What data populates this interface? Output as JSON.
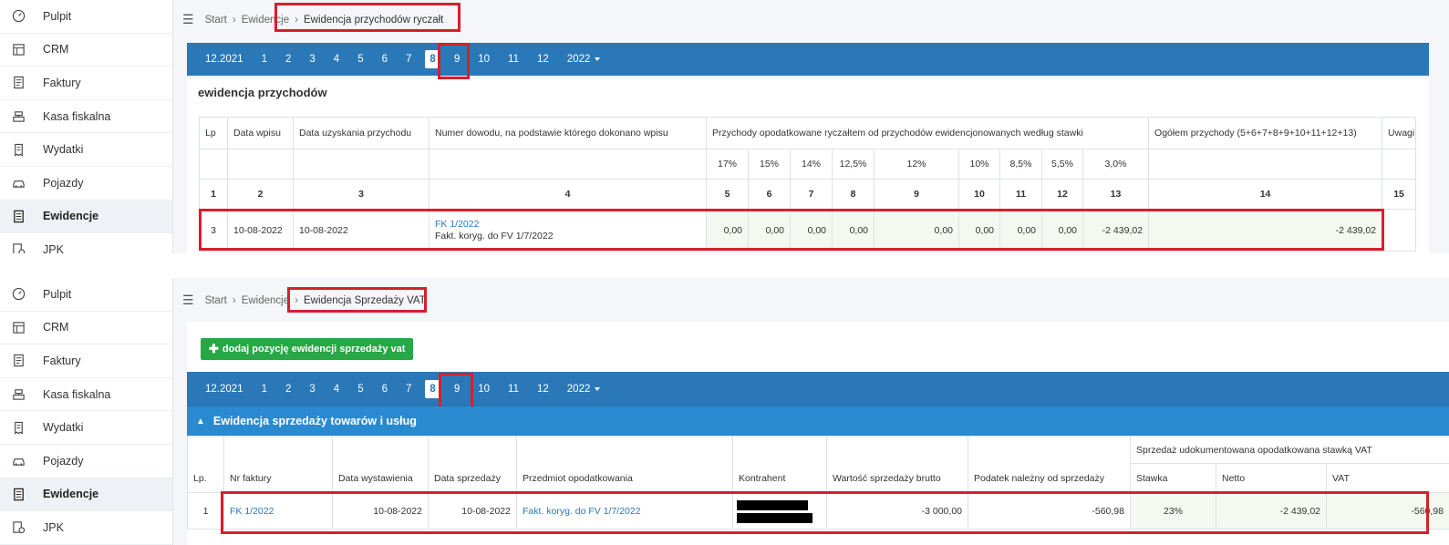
{
  "sidebar": {
    "items": [
      {
        "label": "Pulpit",
        "icon": "dashboard-icon"
      },
      {
        "label": "CRM",
        "icon": "crm-table-icon"
      },
      {
        "label": "Faktury",
        "icon": "invoice-icon"
      },
      {
        "label": "Kasa fiskalna",
        "icon": "cash-register-icon"
      },
      {
        "label": "Wydatki",
        "icon": "receipt-icon"
      },
      {
        "label": "Pojazdy",
        "icon": "car-icon"
      },
      {
        "label": "Ewidencje",
        "icon": "document-icon",
        "active": true
      },
      {
        "label": "JPK",
        "icon": "jpk-icon"
      }
    ]
  },
  "panelA": {
    "breadcrumb": {
      "start": "Start",
      "middle": "Ewidencje",
      "current": "Ewidencja przychodów ryczałt"
    },
    "months": [
      "12.2021",
      "1",
      "2",
      "3",
      "4",
      "5",
      "6",
      "7",
      "8",
      "9",
      "10",
      "11",
      "12",
      "2022"
    ],
    "active_month": "8",
    "section_title": "ewidencja przychodów",
    "table": {
      "headers": {
        "lp": "Lp",
        "data_wpisu": "Data wpisu",
        "data_uzyskania": "Data uzyskania przychodu",
        "numer_dowodu": "Numer dowodu, na podstawie którego dokonano wpisu",
        "przychody": "Przychody opodatkowane ryczałtem od przychodów ewidencjonowanych według stawki",
        "ogolem": "Ogółem przychody (5+6+7+8+9+10+11+12+13)",
        "uwagi": "Uwagi"
      },
      "rates": [
        "17%",
        "15%",
        "14%",
        "12,5%",
        "12%",
        "10%",
        "8,5%",
        "5,5%",
        "3,0%"
      ],
      "col_numbers": [
        "1",
        "2",
        "3",
        "4",
        "5",
        "6",
        "7",
        "8",
        "9",
        "10",
        "11",
        "12",
        "13",
        "14",
        "15"
      ],
      "row": {
        "lp": "3",
        "data_wpisu": "10-08-2022",
        "data_uzyskania": "10-08-2022",
        "numer": "FK 1/2022",
        "opis": "Fakt. koryg. do FV 1/7/2022",
        "values": [
          "0,00",
          "0,00",
          "0,00",
          "0,00",
          "0,00",
          "0,00",
          "0,00",
          "0,00",
          "-2 439,02"
        ],
        "ogolem": "-2 439,02"
      }
    }
  },
  "panelB": {
    "breadcrumb": {
      "start": "Start",
      "middle": "Ewidencje",
      "current": "Ewidencja Sprzedaży VAT"
    },
    "add_button": "dodaj pozycję ewidencji sprzedaży vat",
    "months": [
      "12.2021",
      "1",
      "2",
      "3",
      "4",
      "5",
      "6",
      "7",
      "8",
      "9",
      "10",
      "11",
      "12",
      "2022"
    ],
    "active_month": "8",
    "section_title": "Ewidencja sprzedaży towarów i usług",
    "table": {
      "headers": {
        "lp": "Lp.",
        "nr_faktury": "Nr faktury",
        "data_wystawienia": "Data wystawienia",
        "data_sprzedazy": "Data sprzedaży",
        "przedmiot": "Przedmiot opodatkowania",
        "kontrahent": "Kontrahent",
        "wartosc_brutto": "Wartość sprzedaży brutto",
        "podatek_nalezny": "Podatek należny od sprzedaży",
        "group": "Sprzedaż udokumentowana opodatkowana stawką VAT",
        "stawka": "Stawka",
        "netto": "Netto",
        "vat": "VAT"
      },
      "row": {
        "lp": "1",
        "nr_faktury": "FK 1/2022",
        "data_wystawienia": "10-08-2022",
        "data_sprzedazy": "10-08-2022",
        "przedmiot": "Fakt. koryg. do FV 1/7/2022",
        "wartosc_brutto": "-3 000,00",
        "podatek_nalezny": "-560,98",
        "stawka": "23%",
        "netto": "-2 439,02",
        "vat": "-560,98"
      }
    }
  },
  "colors": {
    "accent": "#2a78b7",
    "highlight": "#d81e2c",
    "success": "#27a745"
  }
}
